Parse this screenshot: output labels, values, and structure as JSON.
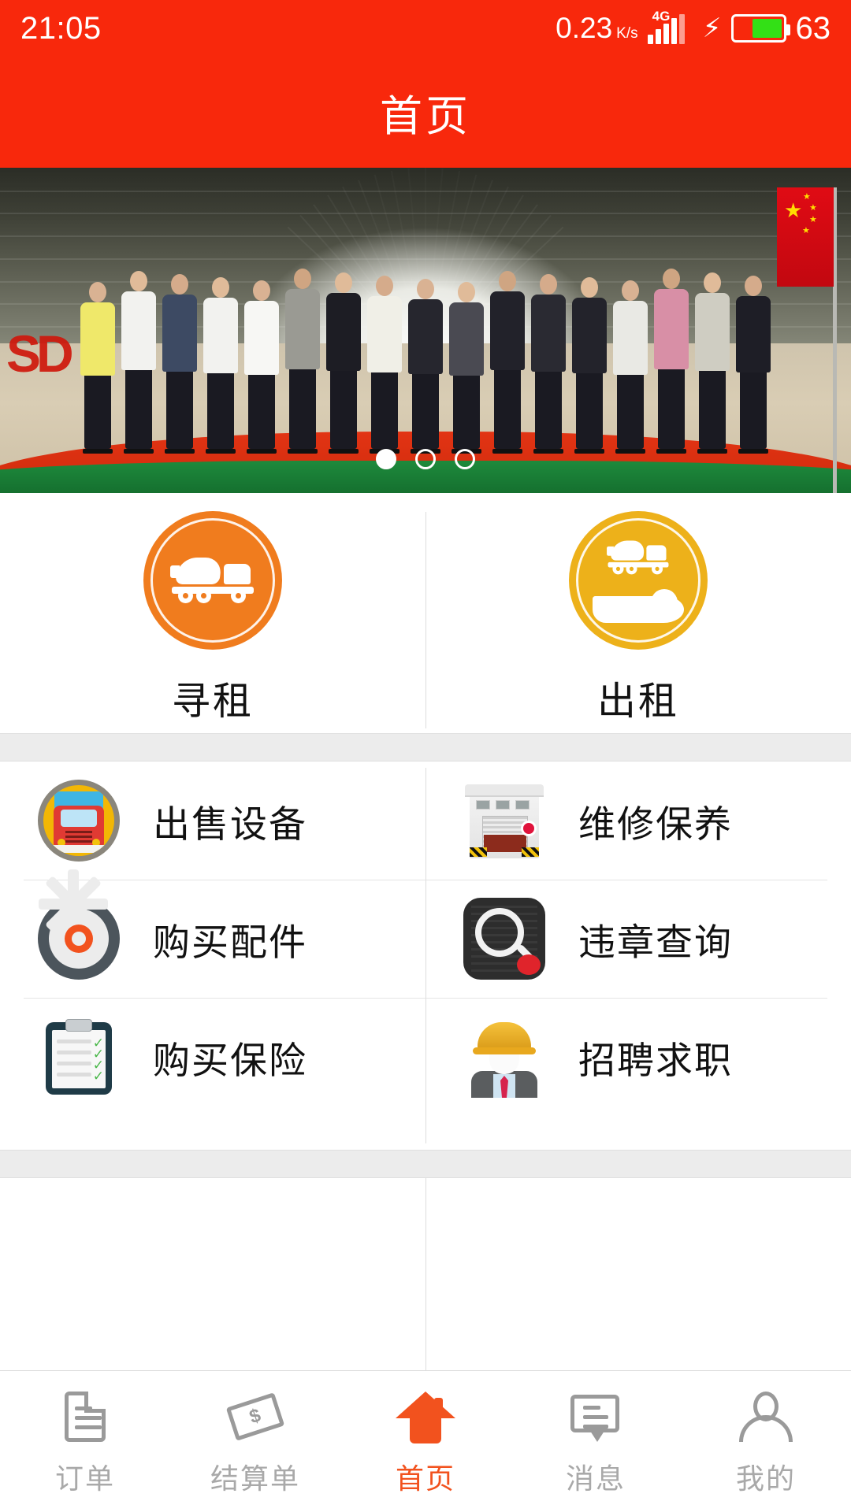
{
  "status_bar": {
    "time": "21:05",
    "network_speed": "0.23",
    "network_speed_unit_top": "K",
    "network_speed_unit_bottom": "s",
    "network_type": "4G",
    "battery_percent": "63",
    "charging_icon": "lightning-bolt-icon",
    "signal_icon": "signal-bars-icon",
    "accent_color": "#F8280C"
  },
  "header": {
    "title": "首页",
    "background_color": "#F8280C",
    "text_color": "#FFFFFF"
  },
  "banner": {
    "name": "promo-carousel",
    "description": "公司团体合影 / 厂房展厅",
    "wall_sign_text": "SD",
    "dots": [
      {
        "active": true
      },
      {
        "active": false
      },
      {
        "active": false
      }
    ]
  },
  "primary_actions": [
    {
      "id": "seek-rent",
      "label": "寻租",
      "icon": "mixer-truck-icon",
      "circle_color": "#F07C1E"
    },
    {
      "id": "offer-rent",
      "label": "出租",
      "icon": "mixer-truck-on-hand-icon",
      "circle_color": "#EDB11A"
    }
  ],
  "services": [
    {
      "id": "sell-equipment",
      "label": "出售设备",
      "icon": "red-truck-front-icon"
    },
    {
      "id": "repair-maintain",
      "label": "维修保养",
      "icon": "garage-workshop-icon"
    },
    {
      "id": "buy-parts",
      "label": "购买配件",
      "icon": "gear-icon"
    },
    {
      "id": "violation-query",
      "label": "违章查询",
      "icon": "magnifier-search-icon"
    },
    {
      "id": "buy-insurance",
      "label": "购买保险",
      "icon": "clipboard-checklist-icon"
    },
    {
      "id": "jobs",
      "label": "招聘求职",
      "icon": "worker-helmet-icon"
    }
  ],
  "tabbar": {
    "active_color": "#F2521E",
    "inactive_color": "#A9A9A9",
    "items": [
      {
        "id": "orders",
        "label": "订单",
        "icon": "document-icon",
        "active": false
      },
      {
        "id": "statement",
        "label": "结算单",
        "icon": "money-bill-icon",
        "active": false
      },
      {
        "id": "home",
        "label": "首页",
        "icon": "home-icon",
        "active": true
      },
      {
        "id": "messages",
        "label": "消息",
        "icon": "chat-bubble-icon",
        "active": false
      },
      {
        "id": "mine",
        "label": "我的",
        "icon": "person-icon",
        "active": false
      }
    ]
  }
}
